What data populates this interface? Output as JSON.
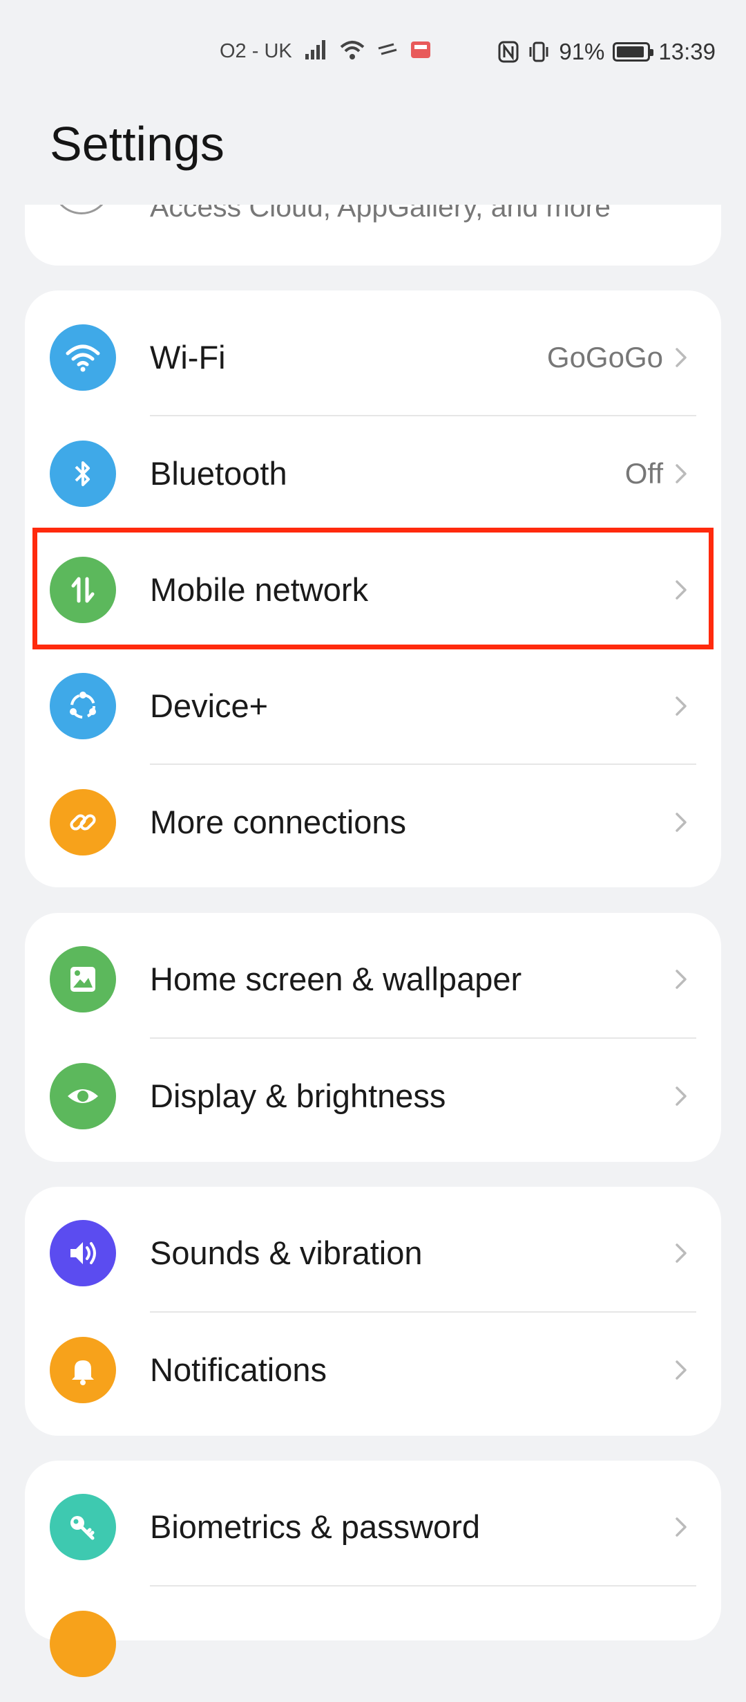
{
  "status_bar": {
    "carrier": "O2 - UK",
    "battery_percent": "91%",
    "battery_level": 0.91,
    "time": "13:39",
    "icons": [
      "signal-icon",
      "wifi-icon",
      "data-arrows-icon",
      "app-notification-icon",
      "nfc-icon",
      "vibrate-icon",
      "battery-icon"
    ]
  },
  "page": {
    "title": "Settings"
  },
  "account": {
    "subtitle": "Access Cloud, AppGallery, and more"
  },
  "groups": [
    {
      "items": [
        {
          "label": "Wi-Fi",
          "value": "GoGoGo",
          "icon": "wifi-icon",
          "color": "#3fa9e8"
        },
        {
          "label": "Bluetooth",
          "value": "Off",
          "icon": "bluetooth-icon",
          "color": "#3fa9e8"
        },
        {
          "label": "Mobile network",
          "value": "",
          "icon": "mobile-data-icon",
          "color": "#5cb85c"
        },
        {
          "label": "Device+",
          "value": "",
          "icon": "device-plus-icon",
          "color": "#3fa9e8"
        },
        {
          "label": "More connections",
          "value": "",
          "icon": "link-icon",
          "color": "#f7a21b"
        }
      ]
    },
    {
      "items": [
        {
          "label": "Home screen & wallpaper",
          "icon": "wallpaper-icon",
          "color": "#5cb85c"
        },
        {
          "label": "Display & brightness",
          "icon": "eye-icon",
          "color": "#5cb85c"
        }
      ]
    },
    {
      "items": [
        {
          "label": "Sounds & vibration",
          "icon": "speaker-icon",
          "color": "#5b4cf0"
        },
        {
          "label": "Notifications",
          "icon": "bell-icon",
          "color": "#f7a21b"
        }
      ]
    },
    {
      "items": [
        {
          "label": "Biometrics & password",
          "icon": "key-icon",
          "color": "#3ec9b0"
        },
        {
          "label": "",
          "icon": "partial-icon",
          "color": "#f7a21b"
        }
      ]
    }
  ],
  "highlight": {
    "target": "Mobile network",
    "color": "#ff2a0d"
  }
}
